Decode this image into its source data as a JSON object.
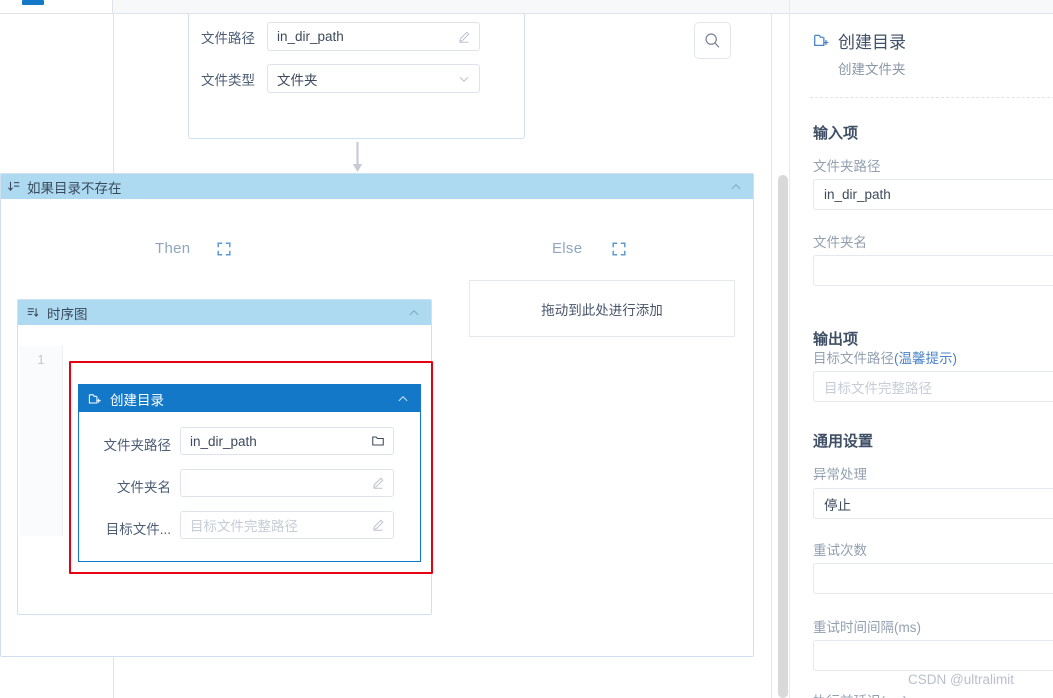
{
  "tabstrip": {
    "active_tab_label": ""
  },
  "canvas": {
    "top_node": {
      "fields": [
        {
          "label": "文件路径",
          "value": "in_dir_path",
          "placeholder": "",
          "icon": "pencil-icon",
          "type": "text"
        },
        {
          "label": "文件类型",
          "value": "文件夹",
          "placeholder": "",
          "icon": "chevron-down-icon",
          "type": "select"
        }
      ]
    },
    "search_button": {
      "icon": "search-icon"
    },
    "connector": {
      "icon": "arrow-down-icon"
    },
    "if_container": {
      "header": {
        "label": "如果目录不存在",
        "icon": "branch-icon",
        "collapse_icon": "chevron-up-icon"
      },
      "then": {
        "label": "Then",
        "expand_icon": "expand-icon",
        "sequence_panel": {
          "header": {
            "label": "时序图",
            "icon": "sequence-icon",
            "collapse_icon": "chevron-up-icon"
          },
          "row_number": "1",
          "card": {
            "title": "创建目录",
            "icon": "folder-plus-icon",
            "collapse_icon": "chevron-up-icon",
            "fields": [
              {
                "label": "文件夹路径",
                "value": "in_dir_path",
                "placeholder": "",
                "icon": "folder-icon"
              },
              {
                "label": "文件夹名",
                "value": "",
                "placeholder": "",
                "icon": "pencil-icon"
              },
              {
                "label": "目标文件...",
                "value": "",
                "placeholder": "目标文件完整路径",
                "icon": "pencil-icon"
              }
            ]
          }
        }
      },
      "else": {
        "label": "Else",
        "expand_icon": "expand-icon",
        "dropzone_label": "拖动到此处进行添加"
      }
    },
    "scrollbar": {
      "name": "vertical-scrollbar"
    }
  },
  "sidebar": {
    "title": "创建目录",
    "title_icon": "folder-plus-icon",
    "subtitle": "创建文件夹",
    "sections": [
      {
        "heading": "输入项",
        "fields": [
          {
            "label": "文件夹路径",
            "value": "in_dir_path",
            "placeholder": ""
          },
          {
            "label": "文件夹名",
            "value": "",
            "placeholder": ""
          }
        ]
      },
      {
        "heading": "输出项",
        "fields": [
          {
            "label": "目标文件路径",
            "label_hint": "(温馨提示)",
            "value": "",
            "placeholder": "目标文件完整路径"
          }
        ]
      },
      {
        "heading": "通用设置",
        "fields": [
          {
            "label": "异常处理",
            "value": "停止",
            "placeholder": ""
          },
          {
            "label": "重试次数",
            "value": "",
            "placeholder": ""
          },
          {
            "label": "重试时间间隔(ms)",
            "value": "",
            "placeholder": ""
          }
        ]
      }
    ],
    "clipped_bottom_label": "执行前延迟(ms)"
  },
  "watermark": "CSDN @ultralimit",
  "colors": {
    "accent_blue": "#1478c8",
    "header_light_blue": "#addaf0",
    "highlight_red": "#e60012",
    "label_gray": "#93a0b1"
  }
}
